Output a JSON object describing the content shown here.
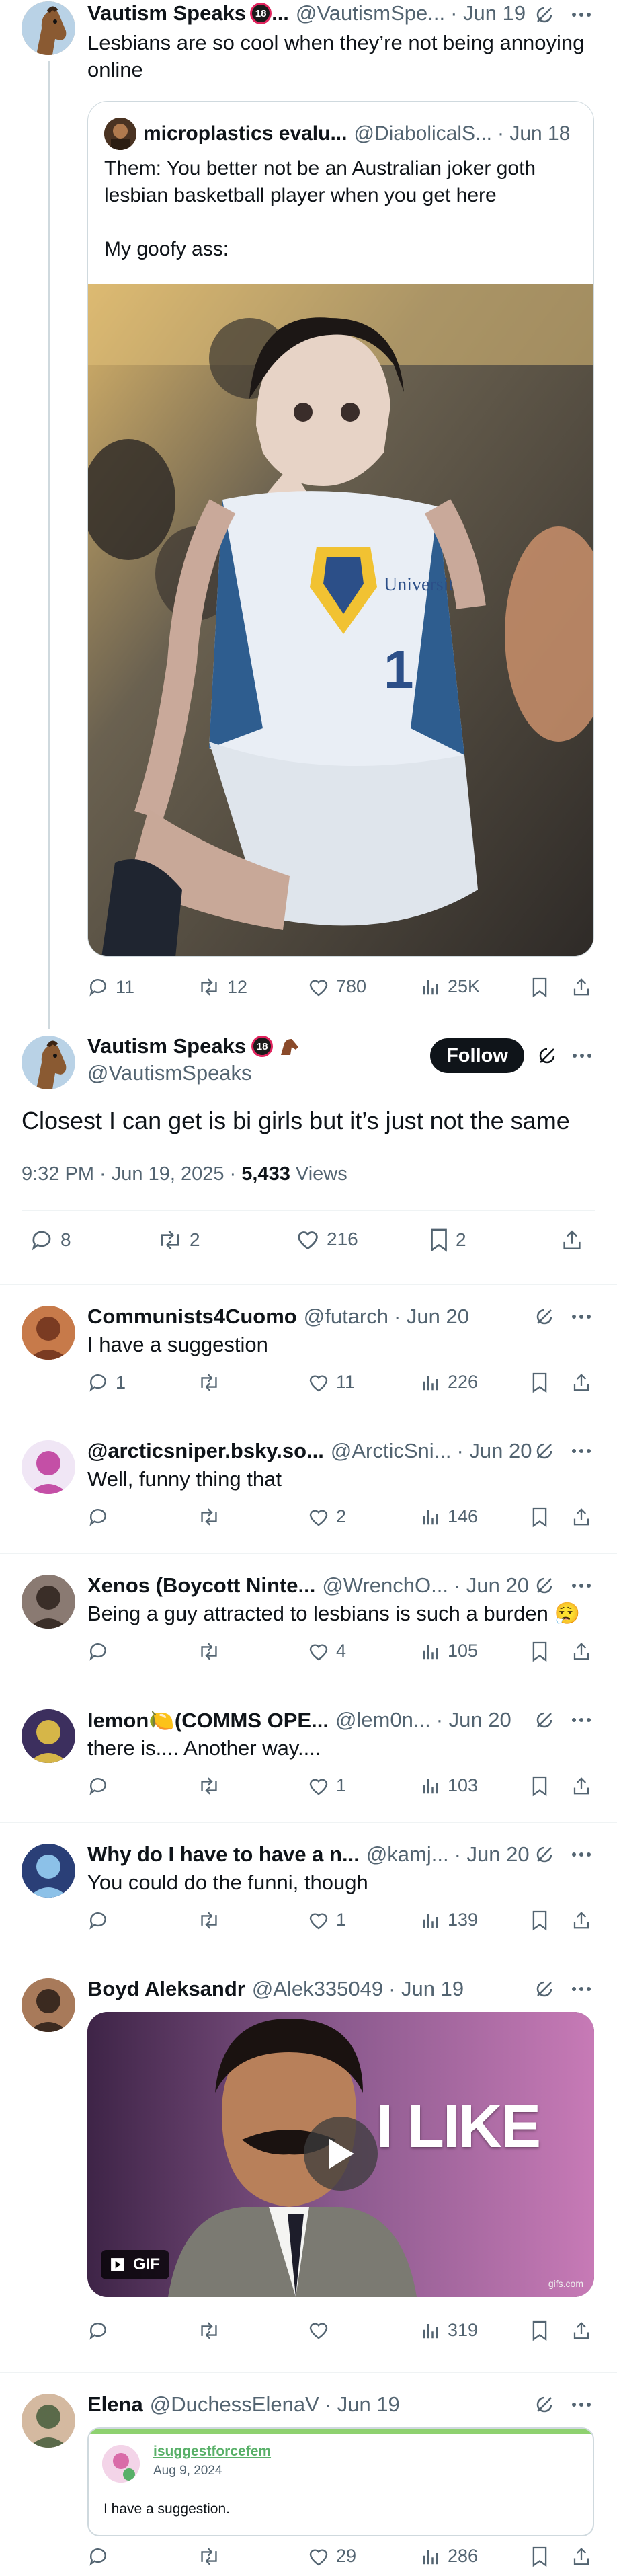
{
  "icons": {
    "reply": "reply-icon",
    "retweet": "retweet-icon",
    "like": "heart-icon",
    "views": "views-icon",
    "bookmark": "bookmark-icon",
    "share": "share-icon",
    "grok": "grok-icon",
    "more": "more-icon"
  },
  "colors": {
    "follow_bg": "#0f1419",
    "link": "#1d9bf0",
    "muted": "#536471"
  },
  "parent_tweet": {
    "name": "Vautism Speaks",
    "handle": "@VautismSpe...",
    "time": "· Jun 19",
    "text": "Lesbians are so cool when they’re not being annoying online",
    "quote": {
      "name": "microplastics evalu...",
      "handle": "@DiabolicalS...",
      "time": "· Jun 18",
      "text": "Them: You better not be an Australian joker goth lesbian basketball player when you get here\n\nMy goofy ass:",
      "image_alt": "Basketball player in University Australia jersey number 1",
      "jersey_text": "University",
      "jersey_number": "1"
    },
    "stats": {
      "replies": "11",
      "retweets": "12",
      "likes": "780",
      "views": "25K"
    }
  },
  "main_tweet": {
    "name": "Vautism Speaks",
    "handle": "@VautismSpeaks",
    "badge": "18",
    "follow_label": "Follow",
    "text": "Closest I can get is bi girls but it’s just not the same",
    "date": "9:32 PM · Jun 19, 2025 · ",
    "views_count": "5,433",
    "views_label": " Views",
    "stats": {
      "replies": "8",
      "retweets": "2",
      "likes": "216",
      "bookmarks": "2"
    }
  },
  "replies": [
    {
      "name": "Communists4Cuomo",
      "handle": "@futarch",
      "time": "· Jun 20",
      "text": "I have a suggestion",
      "replies": "1",
      "retweets": "",
      "likes": "11",
      "views": "226"
    },
    {
      "name": "@arcticsniper.bsky.so...",
      "handle": "@ArcticSni...",
      "time": "· Jun 20",
      "text": "Well, funny thing that",
      "replies": "",
      "retweets": "",
      "likes": "2",
      "views": "146"
    },
    {
      "name": "Xenos (Boycott Ninte...",
      "handle": "@WrenchO...",
      "time": "· Jun 20",
      "text": "Being a guy attracted to lesbians is such a burden 😮‍💨",
      "replies": "",
      "retweets": "",
      "likes": "4",
      "views": "105"
    },
    {
      "name": "lemon🍋(COMMS OPE...",
      "handle": "@lem0n...",
      "time": "· Jun 20",
      "text": "there is.... Another way....",
      "replies": "",
      "retweets": "",
      "likes": "1",
      "views": "103"
    },
    {
      "name": "Why do I have to have a n...",
      "handle": "@kamj...",
      "time": "· Jun 20",
      "text": "You could do the funni, though",
      "replies": "",
      "retweets": "",
      "likes": "1",
      "views": "139"
    },
    {
      "name": "Boyd Aleksandr",
      "handle": "@Alek335049",
      "time": "· Jun 19",
      "text": "",
      "gif_caption": "I LIKE",
      "gif_label": "GIF",
      "gif_watermark": "gifs.com",
      "replies": "",
      "retweets": "",
      "likes": "",
      "views": "319"
    },
    {
      "name": "Elena",
      "handle": "@DuchessElenaV",
      "time": "· Jun 19",
      "text": "",
      "embed": {
        "name": "isuggestforcefem",
        "date": "Aug 9, 2024",
        "text": "I have a suggestion."
      },
      "replies": "",
      "retweets": "",
      "likes": "29",
      "views": "286"
    }
  ]
}
